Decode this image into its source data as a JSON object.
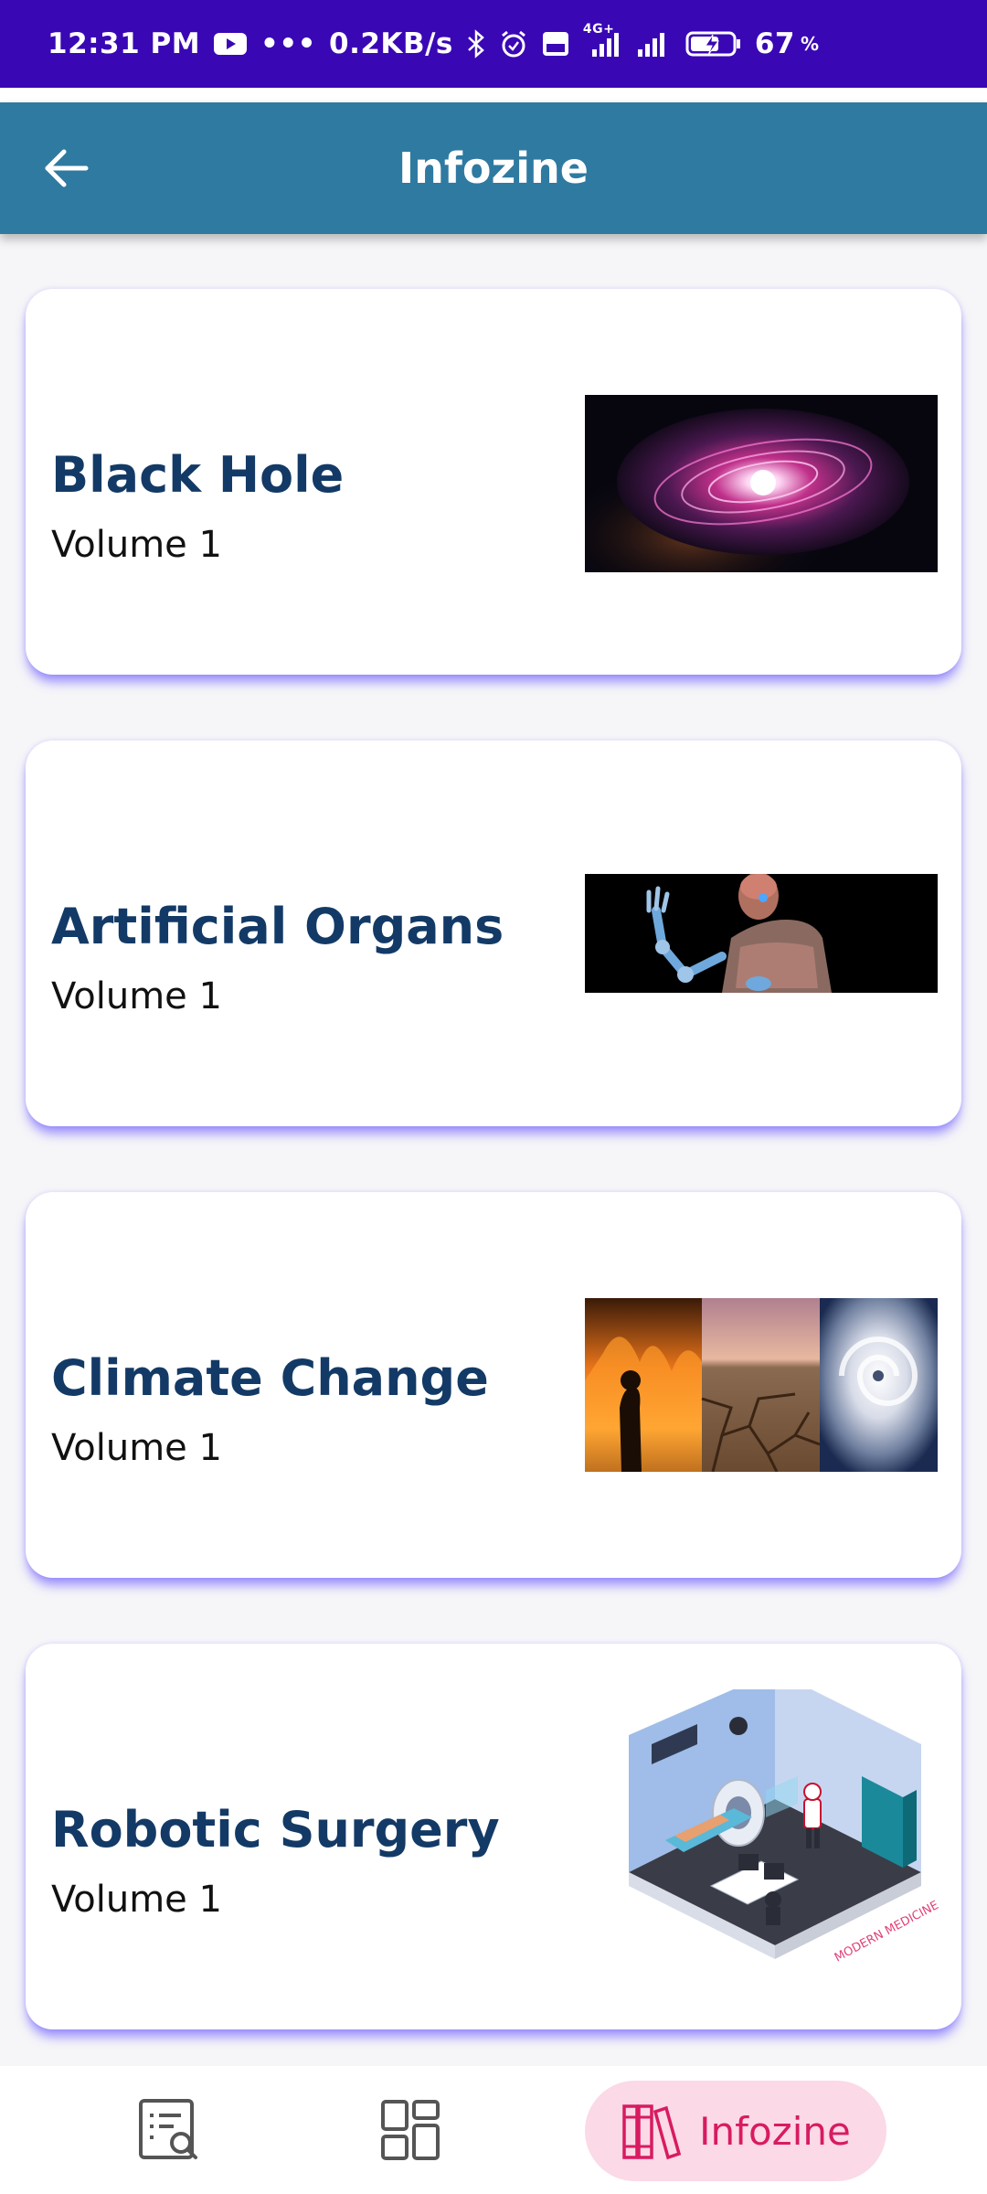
{
  "status_bar": {
    "time": "12:31 PM",
    "dots": "•••",
    "speed": "0.2KB/s",
    "signal_4g": "4G+",
    "battery": "67",
    "battery_unit": "%"
  },
  "app_bar": {
    "title": "Infozine"
  },
  "cards": [
    {
      "title": "Black Hole",
      "subtitle": "Volume 1",
      "image": "galaxy-nebula-image"
    },
    {
      "title": "Artificial Organs",
      "subtitle": "Volume 1",
      "image": "robotic-human-image"
    },
    {
      "title": "Climate Change",
      "subtitle": "Volume 1",
      "image": "fire-drought-hurricane-image"
    },
    {
      "title": "Robotic Surgery",
      "subtitle": "Volume 1",
      "image": "isometric-operating-room-image",
      "image_caption": "MODERN MEDICINE"
    }
  ],
  "bottom_nav": {
    "items": [
      {
        "icon": "list-search-icon"
      },
      {
        "icon": "dashboard-grid-icon"
      },
      {
        "icon": "books-icon",
        "label": "Infozine",
        "active": true
      }
    ]
  },
  "colors": {
    "status_bar": "#3a07b5",
    "app_bar": "#2f7aa1",
    "card_title": "#133a66",
    "nav_active_bg": "#fbd9e6",
    "nav_active_text": "#d81b60"
  }
}
